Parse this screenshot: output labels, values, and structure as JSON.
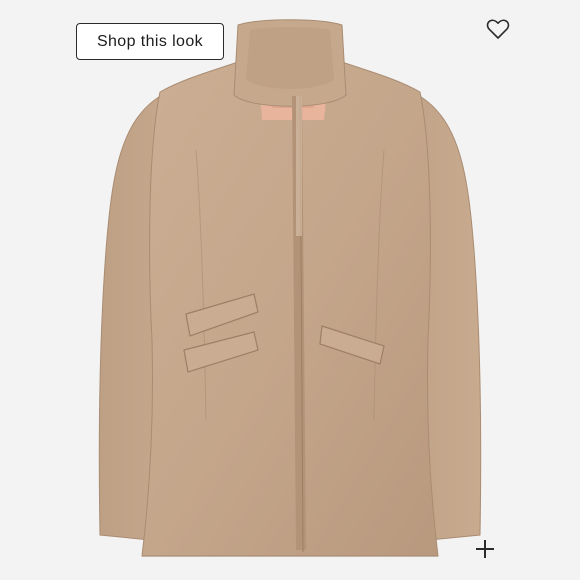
{
  "toolbar": {
    "shop_label": "Shop this look",
    "like_icon": "heart-outline-icon",
    "zoom_icon": "plus-icon"
  },
  "product": {
    "coat_color": "#c4a68b",
    "lining_color": "#e9b49c",
    "background_color": "#f3f3f3"
  }
}
